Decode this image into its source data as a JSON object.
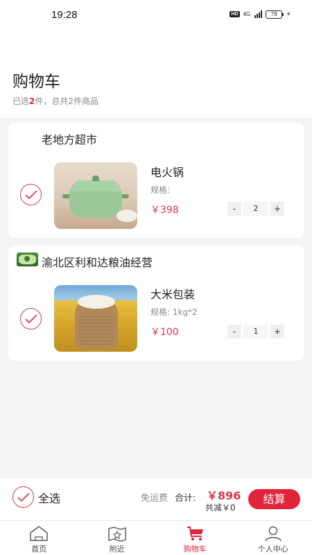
{
  "status_bar": {
    "time": "19:28",
    "hd": "HD",
    "network": "4G",
    "battery": "79"
  },
  "header": {
    "title": "购物车",
    "subtitle_prefix": "已选",
    "selected_count": "2",
    "subtitle_suffix": "件，总共2件商品"
  },
  "shops": [
    {
      "name": "老地方超市",
      "product": {
        "name": "电火锅",
        "spec": "规格:",
        "price": "￥398",
        "quantity": "2",
        "minus": "-",
        "plus": "+"
      }
    },
    {
      "name": "渝北区利和达粮油经营",
      "product": {
        "name": "大米包装",
        "spec": "规格:  1kg*2",
        "price": "￥100",
        "quantity": "1",
        "minus": "-",
        "plus": "+"
      }
    }
  ],
  "footer": {
    "select_all": "全选",
    "free_shipping": "免运费",
    "total_label": "合计:",
    "total_value": "￥896",
    "discount": "共减￥0",
    "checkout": "结算"
  },
  "tabs": [
    {
      "label": "首页",
      "icon": "home-icon"
    },
    {
      "label": "附近",
      "icon": "nearby-map-icon"
    },
    {
      "label": "购物车",
      "icon": "cart-icon",
      "active": true
    },
    {
      "label": "个人中心",
      "icon": "user-icon"
    }
  ],
  "colors": {
    "accent": "#e0243a",
    "check": "#d23a4c"
  }
}
